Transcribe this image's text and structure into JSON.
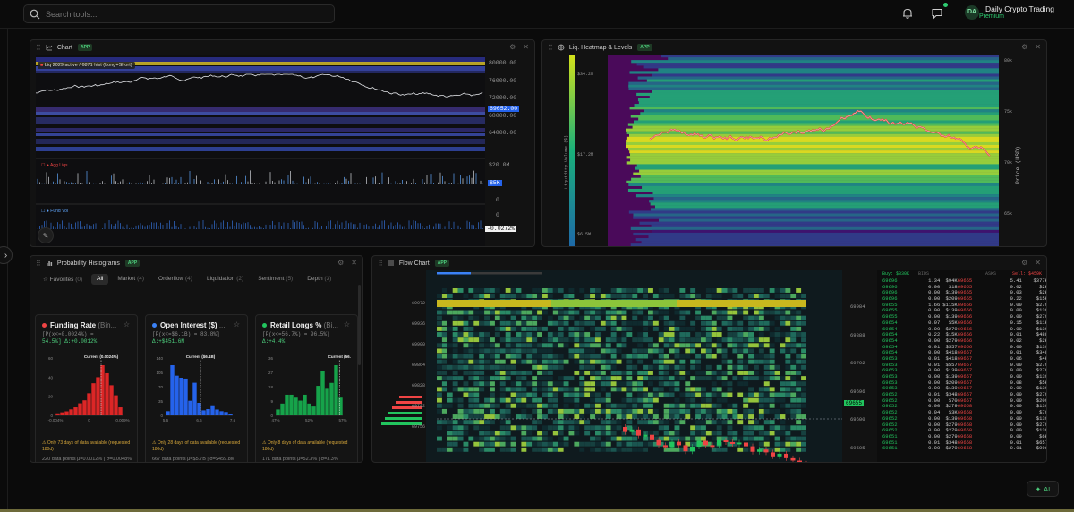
{
  "search": {
    "placeholder": "Search tools..."
  },
  "user": {
    "initials": "DA",
    "name": "Daily Crypto Trading",
    "tier": "Premium"
  },
  "ai_button": {
    "label": "AI"
  },
  "colors": {
    "accent": "#2ecc71",
    "up": "#22c55e",
    "down": "#ef4444",
    "price_tag": "#2563eb"
  },
  "chart_panel": {
    "title": "Chart",
    "badge": "APP",
    "legend": "Liq 2029 active / 6871 hist (Long+Short)",
    "price_axis": [
      "80000.00",
      "76000.00",
      "72000.00",
      "68000.00",
      "64000.00"
    ],
    "current_price": "69652.00",
    "sub1": {
      "name": "Agg Liqs",
      "value": "$20.0M",
      "tag": "$5K",
      "zero": "0"
    },
    "sub2": {
      "name": "Fund Vol",
      "value": "0",
      "tag": "-0.0272%"
    }
  },
  "heatmap_panel": {
    "title": "Liq. Heatmap & Levels",
    "badge": "APP",
    "volume_ticks": [
      "$34.2M",
      "$17.2M",
      "$6.5M"
    ],
    "volume_axis_label": "Liquidity Volume ($)",
    "price_ticks": [
      "80k",
      "75k",
      "70k",
      "65k"
    ],
    "price_axis_label": "Price (USD)"
  },
  "histogram_panel": {
    "title": "Probability Histograms",
    "badge": "APP",
    "tabs": [
      {
        "label": "Favorites",
        "count": "(0)"
      },
      {
        "label": "All",
        "count": ""
      },
      {
        "label": "Market",
        "count": "(4)"
      },
      {
        "label": "Orderflow",
        "count": "(4)"
      },
      {
        "label": "Liquidation",
        "count": "(2)"
      },
      {
        "label": "Sentiment",
        "count": "(5)"
      },
      {
        "label": "Depth",
        "count": "(3)"
      }
    ],
    "cards": [
      {
        "title": "Funding Rate",
        "sub": "(Bin...",
        "line1": "[P(x<=0.0024%) =",
        "line2": "54.5%] Δ:+0.0012%",
        "current": "Current (0.0024%)",
        "y_ticks": [
          "60",
          "40",
          "20",
          "0"
        ],
        "x_ticks": [
          "-0.004%",
          "0",
          "0.009%"
        ],
        "bars": [
          2,
          3,
          4,
          6,
          8,
          12,
          15,
          22,
          32,
          38,
          50,
          42,
          30,
          20,
          8
        ],
        "warn": "Only 73 days of data available (requested 180d)",
        "stats": "220 data points   μ=0.0012% | σ=0.0048%"
      },
      {
        "title": "Open Interest ($)",
        "sub": "...",
        "line1": "[P(x<=$6.1B) = 83.8%]",
        "line2": "Δ:+$451.6M",
        "current": "Current ($6.1B)",
        "y_ticks": [
          "140",
          "105",
          "70",
          "35",
          "0"
        ],
        "x_ticks": [
          "5.6",
          "6.6",
          "7.6"
        ],
        "bars": [
          10,
          120,
          95,
          90,
          88,
          35,
          78,
          30,
          12,
          15,
          22,
          14,
          10,
          8,
          3
        ],
        "warn": "Only 28 days of data available (requested 180d)",
        "stats": "667 data points   μ=$5.7B | σ=$459.8M"
      },
      {
        "title": "Retail Longs %",
        "sub": "(Bi...",
        "line1": "[P(x<=56.7%) = 96.5%]",
        "line2": "Δ:+4.4%",
        "current": "Current (56.",
        "y_ticks": [
          "36",
          "27",
          "18",
          "9",
          "0"
        ],
        "x_ticks": [
          "47%",
          "52%",
          "57%"
        ],
        "bars": [
          4,
          8,
          14,
          14,
          12,
          10,
          14,
          8,
          6,
          20,
          30,
          18,
          22,
          34,
          12
        ],
        "warn": "Only 8 days of data available (requested 180d)",
        "stats": "171 data points   μ=52.3% | σ=3.3%"
      }
    ]
  },
  "flow_panel": {
    "title": "Flow Chart",
    "badge": "APP",
    "left_ticks": [
      "69972",
      "69936",
      "69900",
      "69864",
      "69828",
      "69792",
      "69756"
    ],
    "right_ticks": [
      "69984",
      "69888",
      "69792",
      "69696",
      "69600",
      "69505"
    ],
    "current_tag": "69655",
    "ob_header": {
      "buy": "Buy: $330K",
      "bids": "BIDS",
      "asks": "ASKS",
      "sell": "Sell: $459K"
    },
    "ob_rows": [
      [
        "69696",
        "1.34",
        "$94K",
        "69655",
        "5.41",
        "$377K"
      ],
      [
        "69696",
        "0.00",
        "$18",
        "69655",
        "0.02",
        "$2K"
      ],
      [
        "69696",
        "0.00",
        "$139",
        "69655",
        "0.03",
        "$2K"
      ],
      [
        "69696",
        "0.00",
        "$209",
        "69655",
        "0.22",
        "$15K"
      ],
      [
        "69655",
        "1.66",
        "$115K",
        "69656",
        "0.00",
        "$279"
      ],
      [
        "69655",
        "0.00",
        "$139",
        "69656",
        "0.00",
        "$139"
      ],
      [
        "69655",
        "0.00",
        "$139",
        "69656",
        "0.00",
        "$279"
      ],
      [
        "69654",
        "0.07",
        "$5K",
        "69656",
        "0.15",
        "$11K"
      ],
      [
        "69654",
        "0.00",
        "$279",
        "69656",
        "0.00",
        "$139"
      ],
      [
        "69654",
        "0.22",
        "$15K",
        "69656",
        "0.01",
        "$488"
      ],
      [
        "69654",
        "0.00",
        "$279",
        "69656",
        "0.02",
        "$2K"
      ],
      [
        "69654",
        "0.01",
        "$557",
        "69656",
        "0.00",
        "$139"
      ],
      [
        "69654",
        "0.00",
        "$418",
        "69657",
        "0.01",
        "$348"
      ],
      [
        "69653",
        "0.01",
        "$418",
        "69657",
        "0.06",
        "$4K"
      ],
      [
        "69653",
        "0.01",
        "$557",
        "69657",
        "0.00",
        "$279"
      ],
      [
        "69653",
        "0.00",
        "$139",
        "69657",
        "0.00",
        "$279"
      ],
      [
        "69653",
        "0.00",
        "$139",
        "69657",
        "0.00",
        "$139"
      ],
      [
        "69653",
        "0.00",
        "$209",
        "69657",
        "0.08",
        "$5K"
      ],
      [
        "69653",
        "0.00",
        "$139",
        "69657",
        "0.00",
        "$139"
      ],
      [
        "69652",
        "0.01",
        "$348",
        "69657",
        "0.00",
        "$279"
      ],
      [
        "69652",
        "0.00",
        "$70",
        "69657",
        "0.00",
        "$209"
      ],
      [
        "69652",
        "0.00",
        "$279",
        "69658",
        "0.00",
        "$139"
      ],
      [
        "69652",
        "0.04",
        "$3K",
        "69658",
        "0.00",
        "$70"
      ],
      [
        "69652",
        "0.00",
        "$139",
        "69658",
        "0.00",
        "$139"
      ],
      [
        "69652",
        "0.00",
        "$279",
        "69658",
        "0.00",
        "$279"
      ],
      [
        "69652",
        "0.00",
        "$279",
        "69658",
        "0.00",
        "$139"
      ],
      [
        "69651",
        "0.00",
        "$279",
        "69658",
        "0.09",
        "$6K"
      ],
      [
        "69651",
        "0.01",
        "$348",
        "69658",
        "0.01",
        "$657"
      ],
      [
        "69651",
        "0.00",
        "$279",
        "69658",
        "0.01",
        "$906"
      ]
    ]
  }
}
